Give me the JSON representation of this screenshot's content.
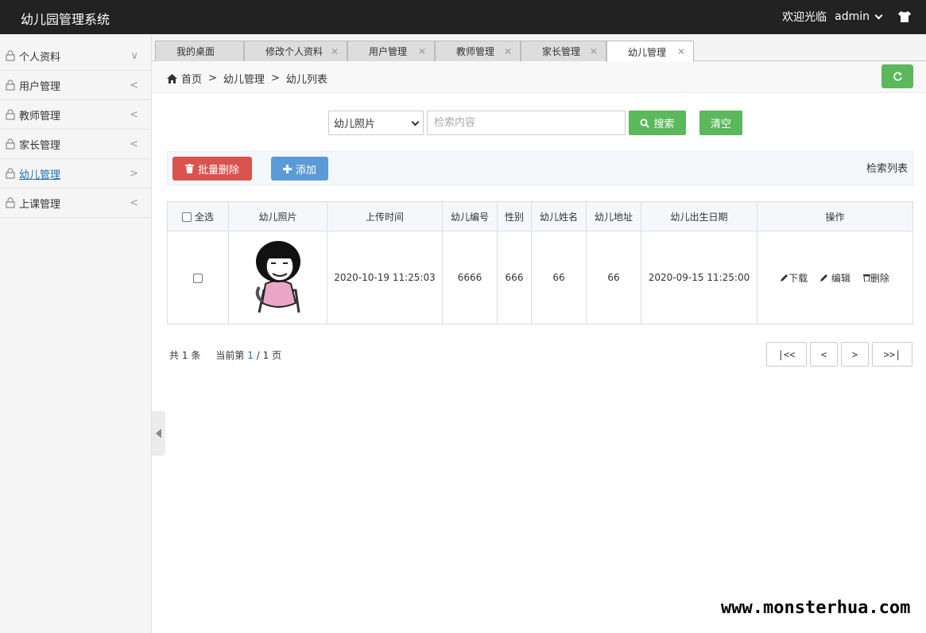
{
  "header": {
    "app_title": "幼儿园管理系统",
    "welcome": "欢迎光临",
    "username": "admin",
    "shirt_icon": "tshirt-icon"
  },
  "sidebar": {
    "items": [
      {
        "label": "个人资料",
        "arrow": "∨"
      },
      {
        "label": "用户管理",
        "arrow": "<"
      },
      {
        "label": "教师管理",
        "arrow": "<"
      },
      {
        "label": "家长管理",
        "arrow": "<"
      },
      {
        "label": "幼儿管理",
        "arrow": ">"
      },
      {
        "label": "上课管理",
        "arrow": "<"
      }
    ],
    "active_index": 4
  },
  "tabs": [
    {
      "label": "我的桌面"
    },
    {
      "label": "修改个人资料"
    },
    {
      "label": "用户管理"
    },
    {
      "label": "教师管理"
    },
    {
      "label": "家长管理"
    },
    {
      "label": "幼儿管理"
    }
  ],
  "breadcrumb": {
    "home": "首页",
    "level1": "幼儿管理",
    "level2": "幼儿列表",
    "sep": ">"
  },
  "search": {
    "field_selected": "幼儿照片",
    "placeholder": "检索内容",
    "search_label": "搜索",
    "clear_label": "清空"
  },
  "actions": {
    "batch_delete": "批量删除",
    "add": "添加",
    "list_title": "检索列表"
  },
  "table": {
    "headers": [
      "全选",
      "幼儿照片",
      "上传时间",
      "幼儿编号",
      "性别",
      "幼儿姓名",
      "幼儿地址",
      "幼儿出生日期",
      "操作"
    ],
    "rows": [
      {
        "upload_time": "2020-10-19 11:25:03",
        "child_no": "6666",
        "gender": "666",
        "name": "66",
        "address": "66",
        "birth_date": "2020-09-15 11:25:00",
        "op_download": "下载",
        "op_edit": "编辑",
        "op_delete": "删除"
      }
    ]
  },
  "pager": {
    "total_prefix": "共",
    "total_count": "1",
    "total_suffix": "条",
    "current_prefix": "当前第",
    "current_page": "1",
    "page_sep": "/",
    "total_pages": "1",
    "page_suffix": "页",
    "first": "|<<",
    "prev": "<",
    "next": ">",
    "last": ">>|"
  },
  "watermark": "www.monsterhua.com",
  "colors": {
    "green": "#5cb85c",
    "red": "#d9534f",
    "blue": "#5b9bd5",
    "topbar": "#222222",
    "link": "#1d6fb8"
  }
}
